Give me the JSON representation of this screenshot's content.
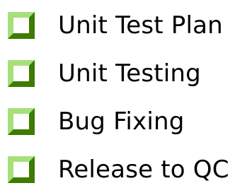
{
  "colors": {
    "checkbox_fill": "#ffffff",
    "checkbox_dark": "#3e7b00",
    "checkbox_light": "#a6e07b",
    "checkbox_mid": "#69b12a",
    "text": "#000000"
  },
  "checklist": {
    "items": [
      {
        "label": "Unit Test Plan",
        "checked": false,
        "icon": "checkbox-icon"
      },
      {
        "label": "Unit Testing",
        "checked": false,
        "icon": "checkbox-icon"
      },
      {
        "label": "Bug Fixing",
        "checked": false,
        "icon": "checkbox-icon"
      },
      {
        "label": "Release to QC",
        "checked": false,
        "icon": "checkbox-icon"
      }
    ]
  }
}
